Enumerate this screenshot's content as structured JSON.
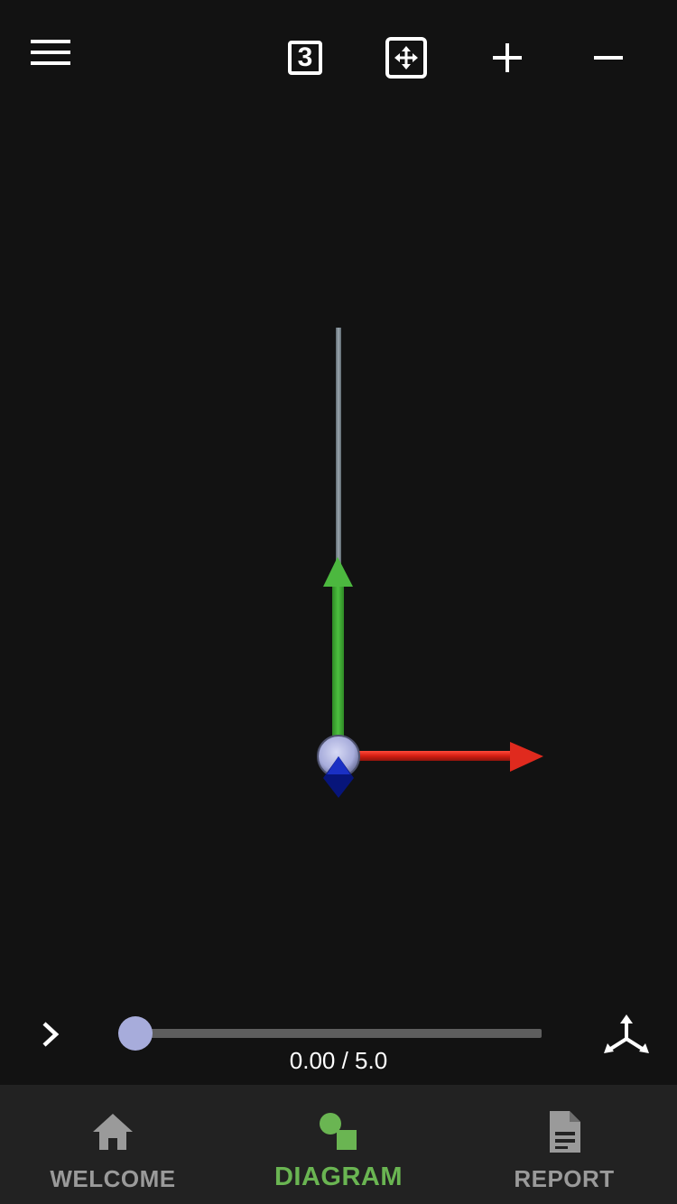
{
  "toolbar": {
    "menu_icon": "hamburger-icon",
    "view_label": "3",
    "fit_icon": "fit-to-screen-icon",
    "zoom_in_icon": "plus-icon",
    "zoom_out_icon": "minus-icon"
  },
  "scene": {
    "colors": {
      "x_axis": "#e8261b",
      "y_axis": "#3fa535",
      "z_axis": "#0b1ea0",
      "rod": "#7d8a94",
      "node": "#a7acdb"
    }
  },
  "playback": {
    "play_icon": "chevron-right-icon",
    "time_label": "0.00 / 5.0",
    "progress": 0.0,
    "triad_icon": "axes-triad-icon"
  },
  "bottom_nav": {
    "items": [
      {
        "label": "WELCOME",
        "icon": "home-icon",
        "active": false
      },
      {
        "label": "DIAGRAM",
        "icon": "shapes-icon",
        "active": true
      },
      {
        "label": "REPORT",
        "icon": "document-icon",
        "active": false
      }
    ]
  },
  "colors": {
    "accent": "#6ab552",
    "inactive": "#9a9a9a",
    "background": "#121212",
    "nav_background": "#222222"
  }
}
